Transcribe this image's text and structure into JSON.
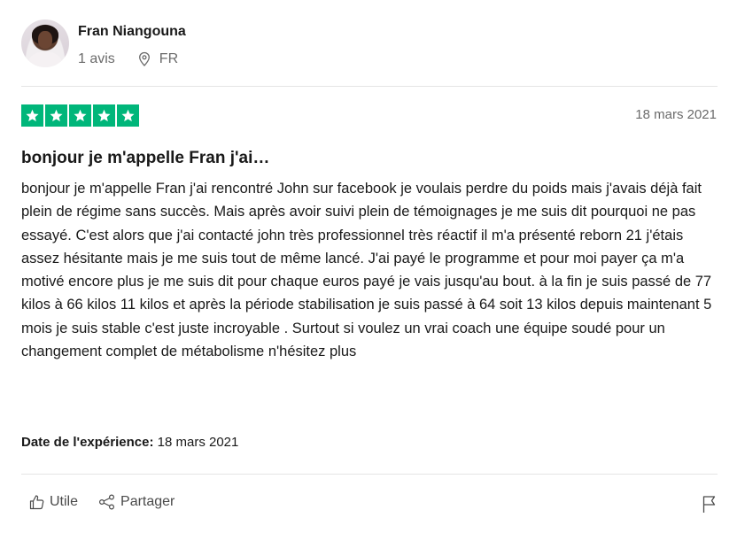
{
  "reviewer": {
    "name": "Fran Niangouna",
    "review_count": "1 avis",
    "country": "FR"
  },
  "review": {
    "rating": 5,
    "date": "18 mars 2021",
    "title": "bonjour je m'appelle Fran j'ai…",
    "body": "bonjour je m'appelle Fran j'ai rencontré John sur facebook je voulais perdre du poids mais j'avais déjà fait plein de régime sans succès. Mais après avoir suivi plein de témoignages je me suis dit pourquoi ne pas essayé. C'est alors que j'ai contacté john très professionnel très réactif il m'a présenté reborn 21 j'étais assez hésitante mais je me suis tout de même lancé. J'ai payé le programme et pour moi payer ça m'a motivé encore plus je me suis dit pour chaque euros payé je vais jusqu'au bout. à la fin je suis passé de 77 kilos à 66 kilos 11 kilos et après la période stabilisation je suis passé à 64 soit 13 kilos depuis maintenant 5 mois je suis stable c'est juste incroyable . Surtout si voulez un vrai coach une équipe soudé pour un changement complet de métabolisme n'hésitez plus",
    "experience_label": "Date de l'expérience:",
    "experience_date": "18 mars 2021"
  },
  "actions": {
    "useful_label": "Utile",
    "share_label": "Partager"
  },
  "colors": {
    "star_green": "#00b67a",
    "text": "#191919",
    "muted": "#6b6b6b"
  },
  "icons": [
    "location-pin-icon",
    "star-icon",
    "thumbs-up-icon",
    "share-icon",
    "flag-icon"
  ]
}
